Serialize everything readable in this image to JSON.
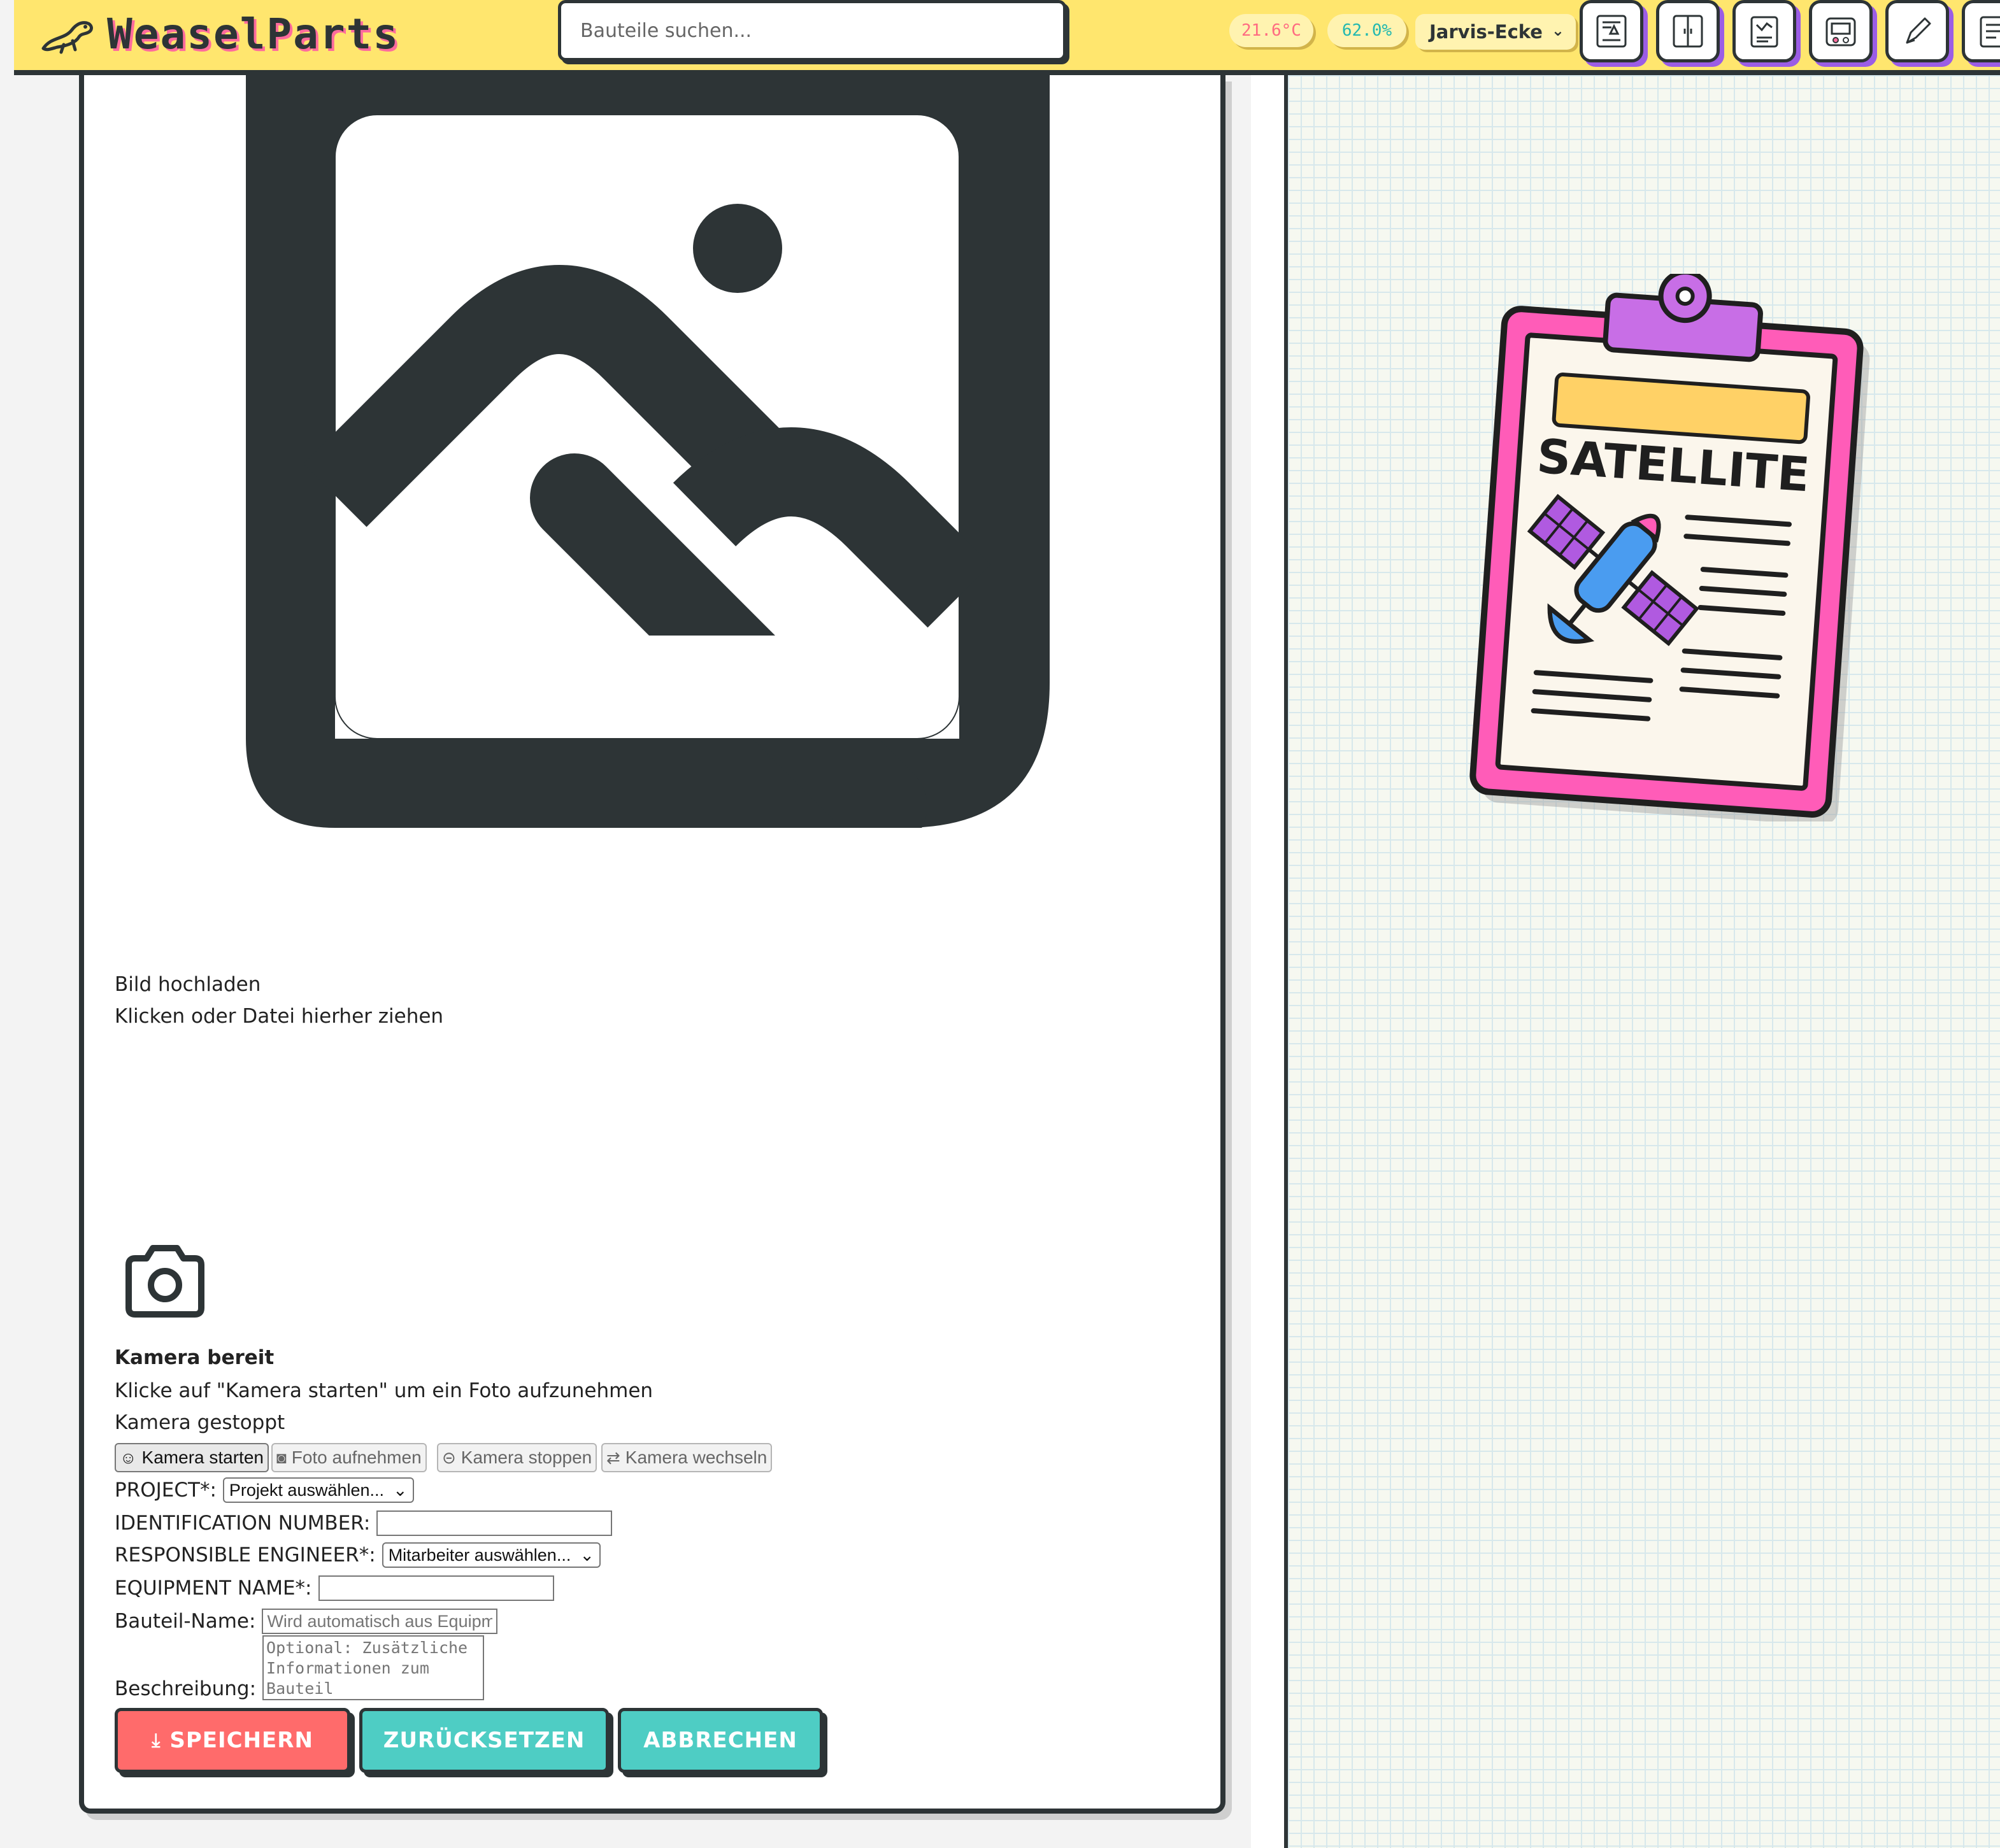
{
  "header": {
    "brand": "WeaselParts",
    "search_placeholder": "Bauteile suchen...",
    "temperature": "21.6°C",
    "humidity": "62.0%",
    "location": "Jarvis-Ecke",
    "tools": [
      "blueprint-icon",
      "cabinet-icon",
      "notes-icon",
      "device-icon",
      "pencil-icon",
      "document-icon"
    ]
  },
  "upload": {
    "title": "Bild hochladen",
    "hint": "Klicken oder Datei hierher ziehen"
  },
  "camera": {
    "status": "Kamera bereit",
    "hint": "Klicke auf \"Kamera starten\" um ein Foto aufzunehmen",
    "state": "Kamera gestoppt",
    "buttons": {
      "start": "Kamera starten",
      "capture": "Foto aufnehmen",
      "stop": "Kamera stoppen",
      "switch": "Kamera wechseln"
    }
  },
  "form": {
    "project_label": "PROJECT*:",
    "project_value": "Projekt auswählen...",
    "id_label": "IDENTIFICATION NUMBER:",
    "engineer_label": "RESPONSIBLE ENGINEER*:",
    "engineer_value": "Mitarbeiter auswählen...",
    "equipment_label": "EQUIPMENT NAME*:",
    "part_name_label": "Bauteil-Name:",
    "part_name_placeholder": "Wird automatisch aus Equipment Name",
    "description_label": "Beschreibung:",
    "description_placeholder": "Optional: Zusätzliche Informationen zum Bauteil"
  },
  "actions": {
    "save": "SPEICHERN",
    "reset": "ZURÜCKSETZEN",
    "cancel": "ABBRECHEN"
  },
  "illustration": {
    "label": "SATELLITE"
  },
  "colors": {
    "header_bg": "#ffe66e",
    "save": "#ff6b6b",
    "reset": "#4ecdc4",
    "cancel": "#4ecdc4",
    "clipboard": "#ff5cb8"
  }
}
